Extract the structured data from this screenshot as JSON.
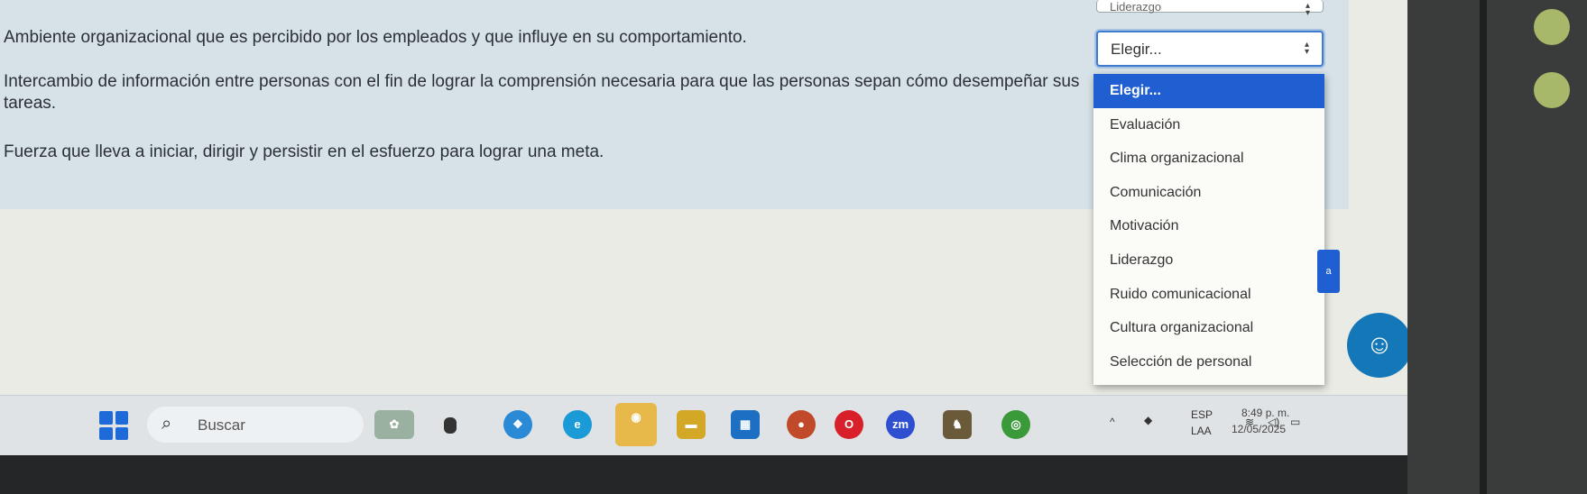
{
  "questions": [
    {
      "text": "Ambiente organizacional que es percibido por los empleados y que influye en su comportamiento."
    },
    {
      "text": "Intercambio de información entre personas con el fin de lograr la comprensión necesaria para que las personas sepan cómo desempeñar sus tareas."
    },
    {
      "text": "Fuerza que lleva a iniciar, dirigir y persistir en el esfuerzo para lograr una meta."
    }
  ],
  "dropdown_top": {
    "value": "Liderazgo"
  },
  "dropdown_open": {
    "value": "Elegir..."
  },
  "options": [
    "Elegir...",
    "Evaluación",
    "Clima organizacional",
    "Comunicación",
    "Motivación",
    "Liderazgo",
    "Ruido comunicacional",
    "Cultura organizacional",
    "Selección de personal"
  ],
  "side_button": {
    "label": "a"
  },
  "taskbar": {
    "search_placeholder": "Buscar",
    "zm_label": "zm",
    "lang_1": "ESP",
    "lang_2": "LAA",
    "time": "8:49 p. m.",
    "date": "12/05/2025"
  },
  "colors": {
    "accent": "#1f5fd1",
    "panel": "#d6e2e8"
  },
  "icons": [
    "windows-start-icon",
    "search-icon",
    "widgets-icon",
    "file-explorer-icon",
    "copilot-icon",
    "edge-icon",
    "store-icon",
    "folder-icon",
    "calendar-icon",
    "app-icon",
    "opera-icon",
    "zoom-icon",
    "game-icon",
    "chrome-icon",
    "chevron-up-icon",
    "wifi-icon",
    "volume-icon",
    "battery-icon"
  ]
}
